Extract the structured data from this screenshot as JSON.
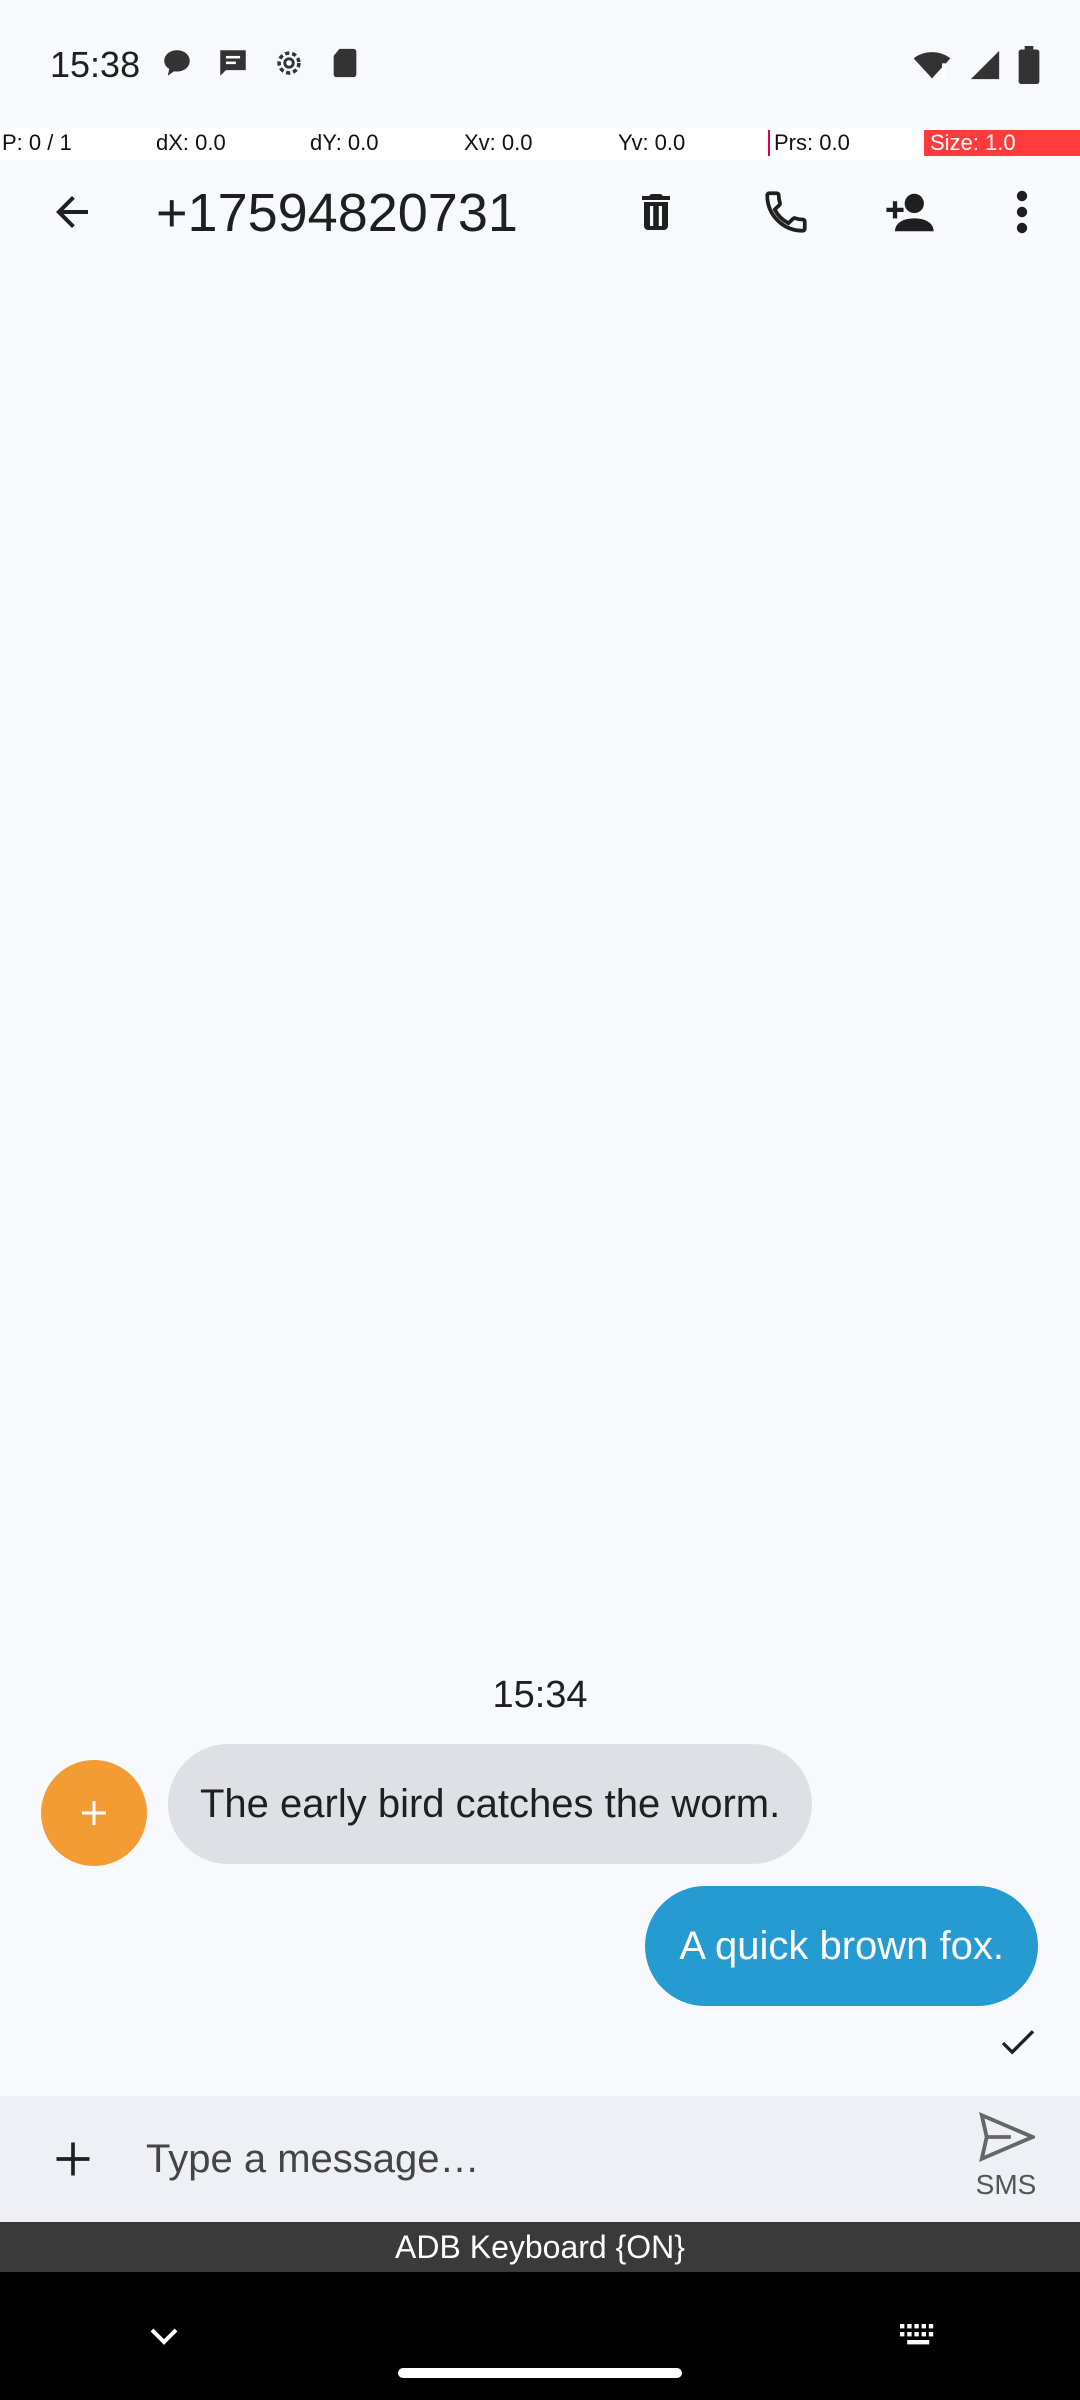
{
  "status_bar": {
    "time": "15:38",
    "left_icons": [
      "chat-bubble-icon",
      "sms-icon",
      "settings-gear-icon",
      "sd-card-icon"
    ],
    "right_icons": [
      "wifi-icon",
      "signal-icon",
      "battery-icon"
    ]
  },
  "pointer_overlay": {
    "p": "P: 0 / 1",
    "dx": "dX: 0.0",
    "dy": "dY: 0.0",
    "xv": "Xv: 0.0",
    "yv": "Yv: 0.0",
    "prs": "Prs: 0.0",
    "size": "Size: 1.0"
  },
  "toolbar": {
    "title": "+17594820731",
    "icons": [
      "back-arrow-icon",
      "delete-icon",
      "phone-icon",
      "add-person-icon",
      "more-vert-icon"
    ]
  },
  "conversation": {
    "timestamp": "15:34",
    "messages": [
      {
        "direction": "incoming",
        "text": "The early bird catches the worm."
      },
      {
        "direction": "outgoing",
        "text": "A quick brown fox.",
        "status": "sent"
      }
    ]
  },
  "compose": {
    "placeholder": "Type a message…",
    "value": "",
    "send_label": "SMS"
  },
  "keyboard_bar": {
    "label": "ADB Keyboard {ON}"
  },
  "colors": {
    "incoming_bubble": "#dfe0e5",
    "outgoing_bubble": "#259bd2",
    "avatar": "#f39c34",
    "background": "#f8f9fd"
  }
}
